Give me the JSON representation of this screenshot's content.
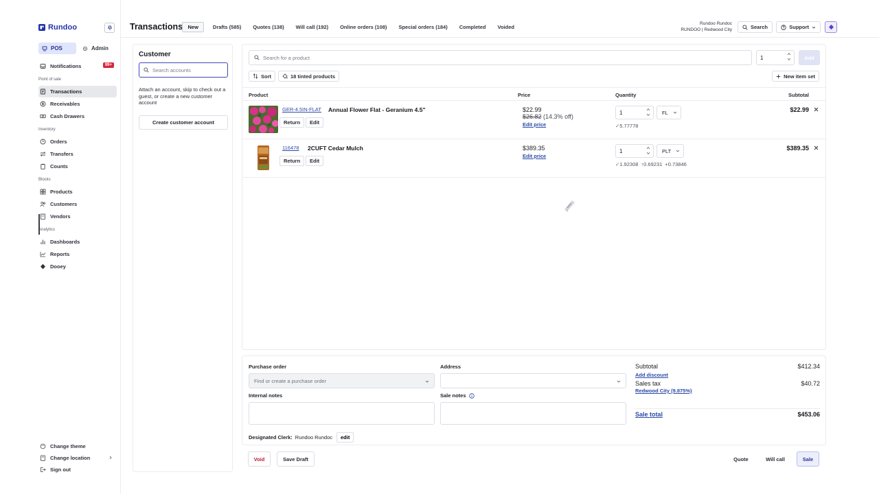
{
  "sidebar": {
    "brand": "Rundoo",
    "modes": {
      "pos": "POS",
      "admin": "Admin"
    },
    "notifications": {
      "label": "Notifications",
      "badge": "99+"
    },
    "sections": {
      "point_of_sale": "Point of sale",
      "inventory": "Inventory",
      "blocks": "Blocks",
      "analytics": "Analytics"
    },
    "items": {
      "transactions": "Transactions",
      "receivables": "Receivables",
      "cash_drawers": "Cash Drawers",
      "orders": "Orders",
      "transfers": "Transfers",
      "counts": "Counts",
      "products": "Products",
      "customers": "Customers",
      "vendors": "Vendors",
      "dashboards": "Dashboards",
      "reports": "Reports",
      "dooey": "Dooey"
    },
    "footer": {
      "change_theme": "Change theme",
      "change_location": "Change location",
      "sign_out": "Sign out"
    }
  },
  "header": {
    "title": "Transactions",
    "tabs": [
      {
        "label": "New",
        "active": true
      },
      {
        "label": "Drafts (585)"
      },
      {
        "label": "Quotes (138)"
      },
      {
        "label": "Will call (192)"
      },
      {
        "label": "Online orders (108)"
      },
      {
        "label": "Special orders (184)"
      },
      {
        "label": "Completed"
      },
      {
        "label": "Voided"
      }
    ],
    "user_name": "Rundoo Rundoc",
    "user_location": "RUNDOO | Redwood City",
    "search_label": "Search",
    "support_label": "Support"
  },
  "customer": {
    "title": "Customer",
    "search_placeholder": "Search accounts",
    "help_text": "Attach an account, skip to check out a guest, or create a new customer account",
    "create_label": "Create customer account"
  },
  "products": {
    "search_placeholder": "Search for a product",
    "quantity": "1",
    "add_label": "Add",
    "sort_label": "Sort",
    "tinted_label": "18 tinted products",
    "new_set_label": "New item set",
    "columns": {
      "product": "Product",
      "price": "Price",
      "quantity": "Quantity",
      "subtotal": "Subtotal"
    },
    "rows": [
      {
        "sku": "GER-4.5IN-FLAT",
        "name": "Annual Flower Flat - Geranium 4.5\"",
        "price": "$22.99",
        "original_price": "$26.82",
        "discount": "(14.3% off)",
        "edit_price": "Edit price",
        "qty": "1",
        "unit": "FL",
        "conversions": [
          "5.77778"
        ],
        "subtotal": "$22.99",
        "return_label": "Return",
        "edit_label": "Edit"
      },
      {
        "sku": "116478",
        "name": "2CUFT Cedar Mulch",
        "price": "$389.35",
        "edit_price": "Edit price",
        "qty": "1",
        "unit": "PLT",
        "conversions": [
          "1.92308",
          "0.69231",
          "0.73846"
        ],
        "subtotal": "$389.35",
        "return_label": "Return",
        "edit_label": "Edit"
      }
    ]
  },
  "order": {
    "po_label": "Purchase order",
    "po_placeholder": "Find or create a purchase order",
    "address_label": "Address",
    "internal_notes_label": "Internal notes",
    "sale_notes_label": "Sale notes",
    "clerk_label": "Designated Clerk:",
    "clerk_name": "Rundoo Rundoc",
    "clerk_edit": "edit"
  },
  "summary": {
    "subtotal_label": "Subtotal",
    "subtotal": "$412.34",
    "add_discount": "Add discount",
    "tax_label": "Sales tax",
    "tax_location": "Redwood City (9.875%)",
    "tax": "$40.72",
    "total_label": "Sale total",
    "total": "$453.06"
  },
  "actions": {
    "void": "Void",
    "save_draft": "Save Draft",
    "quote": "Quote",
    "will_call": "Will call",
    "sale": "Sale"
  },
  "colors": {
    "brand": "#2530a8",
    "link": "#2c4aa8",
    "danger": "#c0203a",
    "badge": "#d7263d",
    "active_nav": "#dfe6fb"
  }
}
